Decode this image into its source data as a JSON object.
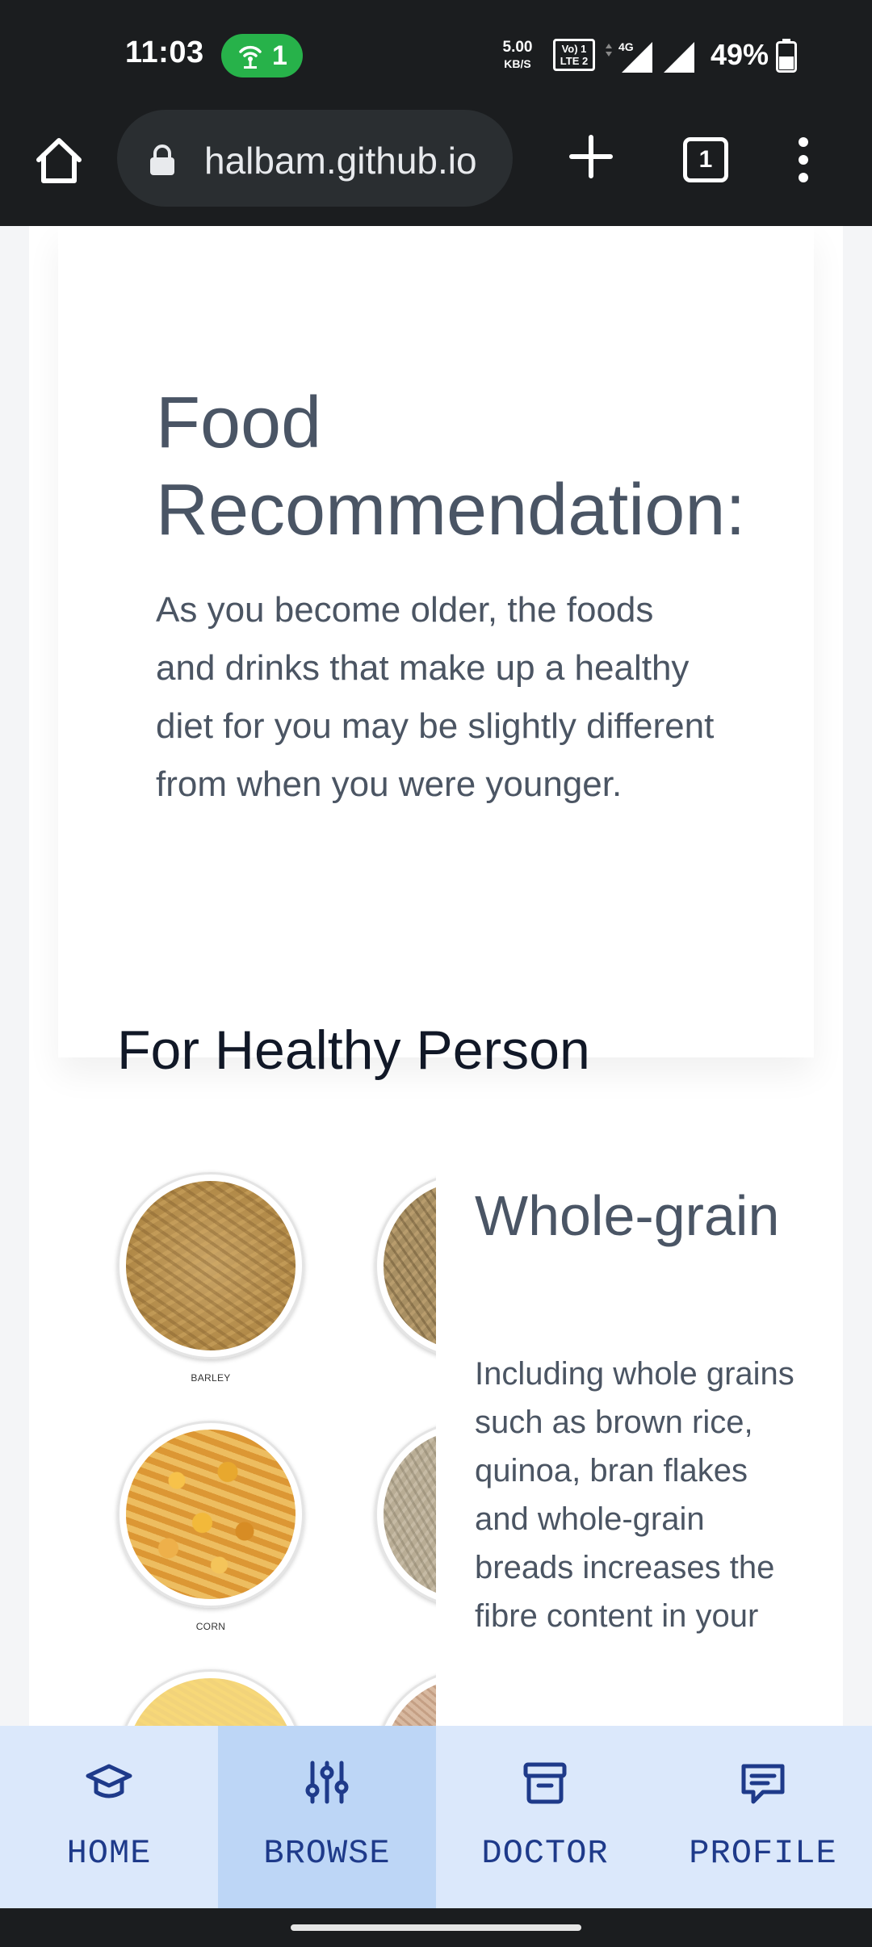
{
  "status_bar": {
    "time": "11:03",
    "hotspot_count": "1",
    "net_speed_value": "5.00",
    "net_speed_unit": "KB/S",
    "volte_line1": "Vo) 1",
    "volte_line2": "LTE 2",
    "network_type": "4G",
    "battery_percent": "49%"
  },
  "browser": {
    "url": "halbam.github.io",
    "tab_count": "1"
  },
  "hero": {
    "title": "Food Recommendation:",
    "text": "As you become older, the foods and drinks that make up a healthy diet for you may be slightly different from when you were younger."
  },
  "section": {
    "heading": "For Healthy Person"
  },
  "gallery": {
    "captions": [
      "BARLEY",
      "CORN"
    ]
  },
  "grain_card": {
    "title": "Whole-grain",
    "text": "Including whole grains such as brown rice, quinoa, bran flakes and whole-grain breads increases the fibre content in your"
  },
  "bottom_nav": {
    "items": [
      {
        "label": "HOME",
        "icon": "graduation-cap-icon",
        "active": false
      },
      {
        "label": "BROWSE",
        "icon": "sliders-icon",
        "active": true
      },
      {
        "label": "DOCTOR",
        "icon": "archive-box-icon",
        "active": false
      },
      {
        "label": "PROFILE",
        "icon": "chat-message-icon",
        "active": false
      }
    ]
  },
  "colors": {
    "status_bg": "#1b1d1f",
    "hotspot_green": "#27b24a",
    "nav_bg": "#dbe8fb",
    "nav_active_bg": "#bdd6f6",
    "nav_text": "#1e3a8a"
  }
}
